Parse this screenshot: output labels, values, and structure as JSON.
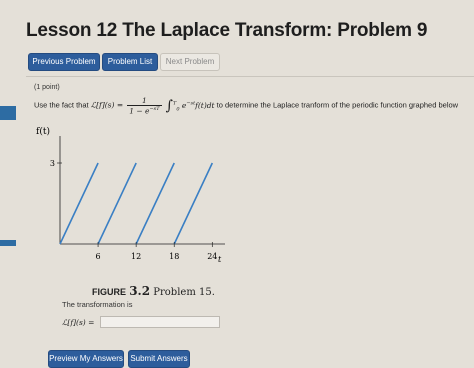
{
  "page": {
    "title": "Lesson 12 The Laplace Transform: Problem 9"
  },
  "nav": {
    "previous_label": "Previous Problem",
    "list_label": "Problem List",
    "next_label": "Next Problem"
  },
  "problem": {
    "points": "(1 point)",
    "intro": "Use the fact that",
    "lhs": "ℒ[f](s) =",
    "frac_num": "1",
    "frac_den": "1 − e",
    "frac_den_exp": "−sT",
    "integral_upper": "T",
    "integral_lower": "0",
    "integrand": "e",
    "integrand_exp": "−st",
    "integrand_rest": "f(t)dt",
    "rest": "to determine the Laplace tranform of the periodic function graphed below"
  },
  "figure": {
    "y_label": "f(t)",
    "y_tick": "3",
    "x_ticks": [
      "6",
      "12",
      "18",
      "24"
    ],
    "x_axis_label": "t",
    "caption_tag": "FIGURE",
    "caption_num": "3.2",
    "caption_text": "Problem 15."
  },
  "answer": {
    "prompt": "The transformation is",
    "label": "ℒ[f](s) =",
    "value": ""
  },
  "actions": {
    "preview_label": "Preview My Answers",
    "submit_label": "Submit Answers"
  },
  "colors": {
    "accent": "#2d5d9c",
    "graph_line": "#3a7fc4",
    "background": "#e4e0d8"
  },
  "chart_data": {
    "type": "line",
    "title": "",
    "xlabel": "t",
    "ylabel": "f(t)",
    "x_ticks": [
      6,
      12,
      18,
      24
    ],
    "y_ticks": [
      3
    ],
    "xlim": [
      0,
      26
    ],
    "ylim": [
      0,
      4
    ],
    "period": 6,
    "series": [
      {
        "x": [
          0,
          6
        ],
        "y": [
          0,
          3
        ]
      },
      {
        "x": [
          6,
          12
        ],
        "y": [
          0,
          3
        ]
      },
      {
        "x": [
          12,
          18
        ],
        "y": [
          0,
          3
        ]
      },
      {
        "x": [
          18,
          24
        ],
        "y": [
          0,
          3
        ]
      }
    ]
  }
}
